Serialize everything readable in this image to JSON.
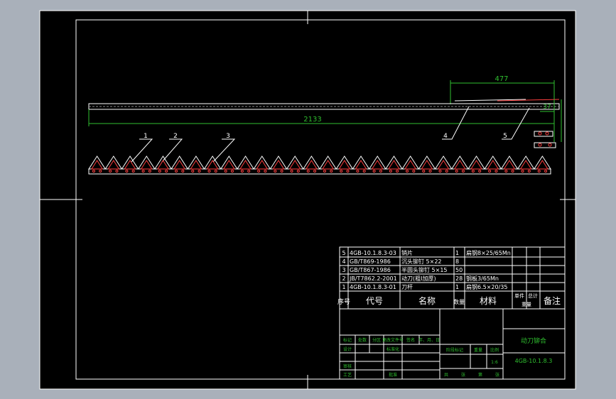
{
  "dimensions": {
    "top": "477",
    "length": "2133",
    "right": "37"
  },
  "leaders": [
    "1",
    "2",
    "3",
    "4",
    "5"
  ],
  "bom": {
    "rows": [
      {
        "no": "5",
        "code": "4GB-10.1.8.3-03",
        "name": "销片",
        "qty": "1",
        "material": "扁钢8×25/65Mn"
      },
      {
        "no": "4",
        "code": "GB/T869-1986",
        "name": "沉头铆钉 5×22",
        "qty": "8",
        "material": ""
      },
      {
        "no": "3",
        "code": "GB/T867-1986",
        "name": "半圆头铆钉 5×15",
        "qty": "50",
        "material": ""
      },
      {
        "no": "2",
        "code": "JB/T7862.2-2001",
        "name": "动刀(粗Ⅰ加厚)",
        "qty": "28",
        "material": "钢板3/65Mn"
      },
      {
        "no": "1",
        "code": "4GB-10.1.8.3-01",
        "name": "刀杆",
        "qty": "1",
        "material": "扁钢6.5×20/35"
      }
    ],
    "header": {
      "no": "序号",
      "code": "代号",
      "name": "名称",
      "qty": "数量",
      "material": "材料",
      "single": "单件",
      "total": "总计",
      "weight": "重量",
      "remark": "备注"
    }
  },
  "titleblock": {
    "title": "动刀铆合",
    "drawing_no": "4GB-10.1.8.3",
    "scale": "1:6",
    "row_labels": [
      "标记",
      "处数",
      "分区",
      "更改文件号",
      "签名",
      "年、月、日"
    ],
    "design": "设计",
    "standard": "标准化",
    "review": "审核",
    "process": "工艺",
    "approve": "批准",
    "stage": "阶段标记",
    "weight": "重量",
    "ratio": "比例",
    "sheet": "共",
    "sheet2": "张",
    "sheet3": "第",
    "sheet4": "张"
  }
}
